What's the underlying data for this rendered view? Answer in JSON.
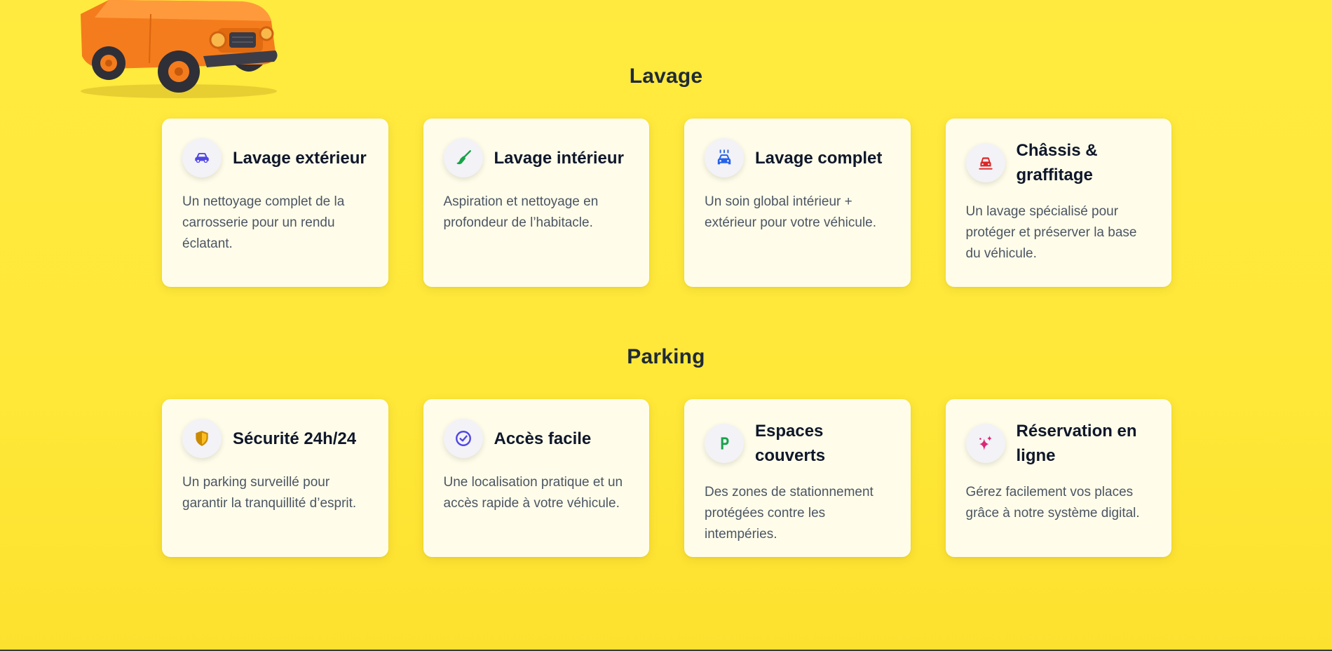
{
  "sections": [
    {
      "title": "Lavage",
      "cards": [
        {
          "icon": "car-icon",
          "icon_color": "#4f46e5",
          "title": "Lavage extérieur",
          "description": "Un nettoyage complet de la carrosserie pour un rendu éclatant."
        },
        {
          "icon": "broom-icon",
          "icon_color": "#16a34a",
          "title": "Lavage intérieur",
          "description": "Aspiration et nettoyage en profondeur de l’habitacle."
        },
        {
          "icon": "car-wash-icon",
          "icon_color": "#2563eb",
          "title": "Lavage complet",
          "description": "Un soin global intérieur + extérieur pour votre véhicule."
        },
        {
          "icon": "car-lift-icon",
          "icon_color": "#dc2626",
          "title": "Châssis & graffitage",
          "description": "Un lavage spécialisé pour protéger et préserver la base du véhicule."
        }
      ]
    },
    {
      "title": "Parking",
      "cards": [
        {
          "icon": "shield-icon",
          "icon_color": "#ca8a04",
          "title": "Sécurité 24h/24",
          "description": "Un parking surveillé pour garantir la tranquillité d’esprit."
        },
        {
          "icon": "check-circle-icon",
          "icon_color": "#4f46e5",
          "title": "Accès facile",
          "description": "Une localisation pratique et un accès rapide à votre véhicule."
        },
        {
          "icon": "parking-icon",
          "icon_color": "#16a34a",
          "title": "Espaces couverts",
          "description": "Des zones de stationnement protégées contre les intempéries."
        },
        {
          "icon": "sparkles-icon",
          "icon_color": "#db2777",
          "title": "Réservation en ligne",
          "description": "Gérez facilement vos places grâce à notre système digital."
        }
      ]
    }
  ],
  "illustration": {
    "name": "orange-toy-car",
    "body_color": "#f47c1c"
  }
}
